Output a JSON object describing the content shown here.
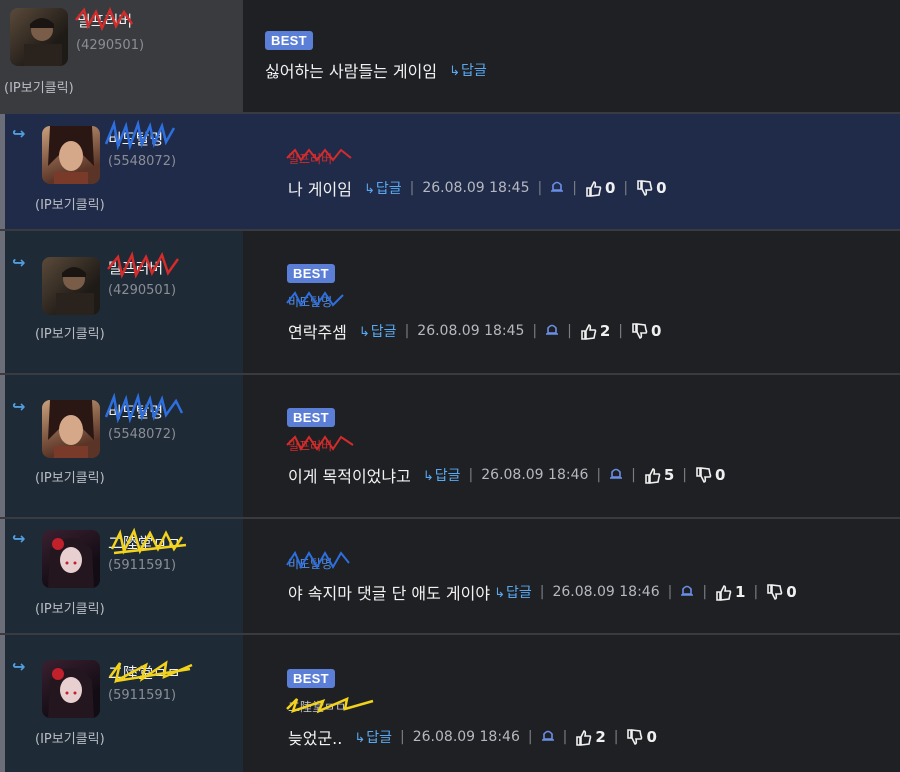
{
  "labels": {
    "ip_click": "(IP보기클릭)",
    "reply": "답글",
    "best": "BEST",
    "separator": "|"
  },
  "comments": [
    {
      "nickname": "밀프러버",
      "user_id": "(4290501)",
      "best": true,
      "text": "싫어하는 사람들는 게이임",
      "is_reply": false
    },
    {
      "nickname": "비도탈명",
      "user_id": "(5548072)",
      "reply_to": "밀프러버",
      "text": "나 게이임",
      "time": "26.08.09 18:45",
      "likes": "0",
      "dislikes": "0",
      "best": false,
      "is_reply": true
    },
    {
      "nickname": "밀프러버",
      "user_id": "(4290501)",
      "reply_to": "비도탈명",
      "text": "연락주셈",
      "time": "26.08.09 18:45",
      "likes": "2",
      "dislikes": "0",
      "best": true,
      "is_reply": true
    },
    {
      "nickname": "비도탈명",
      "user_id": "(5548072)",
      "reply_to": "밀프러버",
      "text": "이게 목적이었냐고",
      "time": "26.08.09 18:46",
      "likes": "5",
      "dislikes": "0",
      "best": true,
      "is_reply": true
    },
    {
      "nickname": "二陸堂ㅁㅁ",
      "user_id": "(5911591)",
      "reply_to": "비도탈명",
      "text": "야 속지마 댓글 단 애도 게이야",
      "time": "26.08.09 18:46",
      "likes": "1",
      "dislikes": "0",
      "best": false,
      "is_reply": true
    },
    {
      "nickname": "二陸堂ㅁㅁ",
      "user_id": "(5911591)",
      "reply_to": "二陸堂ㅁㅁ",
      "text": "늦었군..",
      "time": "26.08.09 18:46",
      "likes": "2",
      "dislikes": "0",
      "best": true,
      "is_reply": true
    }
  ],
  "colors": {
    "accent": "#5b7fd6",
    "link": "#5aa8f0",
    "redact_red": "#d42b2b",
    "redact_blue": "#2e6fe0",
    "redact_yellow": "#f2d21a"
  },
  "icons": {
    "reply": "reply-arrow-icon",
    "report": "bell-icon",
    "like": "thumbs-up-icon",
    "dislike": "thumbs-down-icon"
  }
}
